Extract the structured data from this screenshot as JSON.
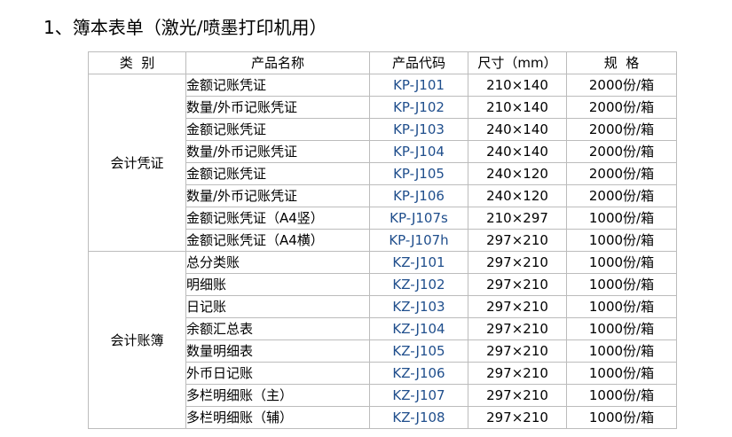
{
  "page": {
    "title": "1、簿本表单（激光/喷墨打印机用）"
  },
  "table": {
    "headers": [
      "类  别",
      "产品名称",
      "产品代码",
      "尺寸（mm）",
      "规  格"
    ],
    "groups": [
      {
        "category": "会计凭证",
        "rows": [
          {
            "name": "金额记账凭证",
            "code": "KP-J101",
            "size": "210×140",
            "spec": "2000份/箱"
          },
          {
            "name": "数量/外币记账凭证",
            "code": "KP-J102",
            "size": "210×140",
            "spec": "2000份/箱"
          },
          {
            "name": "金额记账凭证",
            "code": "KP-J103",
            "size": "240×140",
            "spec": "2000份/箱"
          },
          {
            "name": "数量/外币记账凭证",
            "code": "KP-J104",
            "size": "240×140",
            "spec": "2000份/箱"
          },
          {
            "name": "金额记账凭证",
            "code": "KP-J105",
            "size": "240×120",
            "spec": "2000份/箱"
          },
          {
            "name": "数量/外币记账凭证",
            "code": "KP-J106",
            "size": "240×120",
            "spec": "2000份/箱"
          },
          {
            "name": "金额记账凭证（A4竖）",
            "code": "KP-J107s",
            "size": "210×297",
            "spec": "1000份/箱"
          },
          {
            "name": "金额记账凭证（A4横）",
            "code": "KP-J107h",
            "size": "297×210",
            "spec": "1000份/箱"
          }
        ]
      },
      {
        "category": "会计账簿",
        "rows": [
          {
            "name": "总分类账",
            "code": "KZ-J101",
            "size": "297×210",
            "spec": "1000份/箱"
          },
          {
            "name": "明细账",
            "code": "KZ-J102",
            "size": "297×210",
            "spec": "1000份/箱"
          },
          {
            "name": "日记账",
            "code": "KZ-J103",
            "size": "297×210",
            "spec": "1000份/箱"
          },
          {
            "name": "余额汇总表",
            "code": "KZ-J104",
            "size": "297×210",
            "spec": "1000份/箱"
          },
          {
            "name": "数量明细表",
            "code": "KZ-J105",
            "size": "297×210",
            "spec": "1000份/箱"
          },
          {
            "name": "外币日记账",
            "code": "KZ-J106",
            "size": "297×210",
            "spec": "1000份/箱"
          },
          {
            "name": "多栏明细账（主）",
            "code": "KZ-J107",
            "size": "297×210",
            "spec": "1000份/箱"
          },
          {
            "name": "多栏明细账（辅）",
            "code": "KZ-J108",
            "size": "297×210",
            "spec": "1000份/箱"
          }
        ]
      }
    ]
  },
  "colors": {
    "code_text": "#1f4e8c",
    "border": "#bcbcbc"
  }
}
